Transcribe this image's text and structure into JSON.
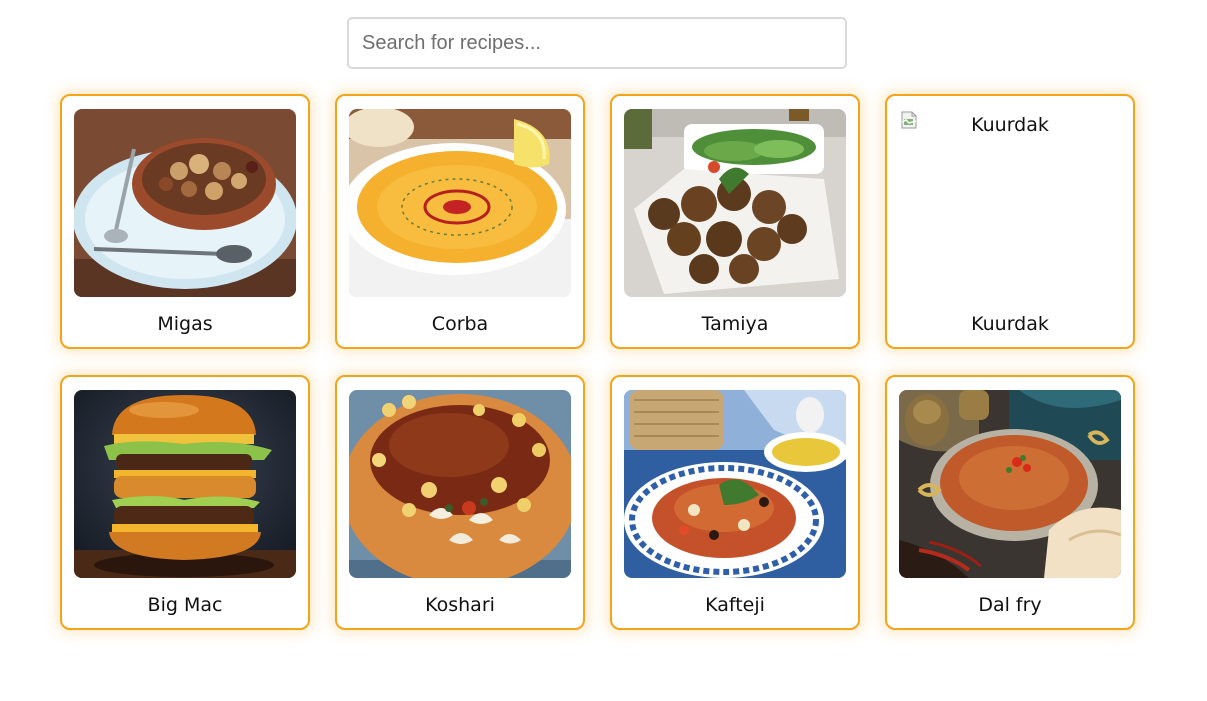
{
  "search": {
    "placeholder": "Search for recipes...",
    "value": ""
  },
  "recipes": [
    {
      "title": "Migas",
      "image_alt": "",
      "image": "migas-photo"
    },
    {
      "title": "Corba",
      "image_alt": "",
      "image": "corba-photo"
    },
    {
      "title": "Tamiya",
      "image_alt": "",
      "image": "tamiya-photo"
    },
    {
      "title": "Kuurdak",
      "image_alt": "Kuurdak",
      "image": "broken-image"
    },
    {
      "title": "Big Mac",
      "image_alt": "",
      "image": "big-mac-photo"
    },
    {
      "title": "Koshari",
      "image_alt": "",
      "image": "koshari-photo"
    },
    {
      "title": "Kafteji",
      "image_alt": "",
      "image": "kafteji-photo"
    },
    {
      "title": "Dal fry",
      "image_alt": "",
      "image": "dal-fry-photo"
    }
  ],
  "colors": {
    "card_border": "#f4a417",
    "card_glow": "#ffc46e",
    "search_border": "#d9d9d9"
  }
}
